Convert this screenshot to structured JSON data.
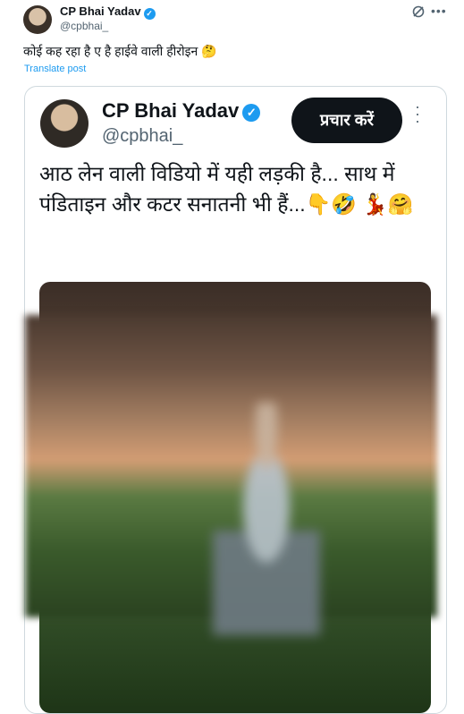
{
  "tweet": {
    "author_name": "CP Bhai Yadav",
    "handle": "@cpbhai_",
    "text": "कोई कह रहा है ए है हाईवे वाली हीरोइन 🤔",
    "translate_label": "Translate post"
  },
  "quoted": {
    "author_name": "CP Bhai Yadav",
    "handle": "@cpbhai_",
    "promote_label": "प्रचार करें",
    "text": "आठ लेन वाली विडियो में यही लड़की है... साथ में पंडिताइन और कटर सनातनी भी हैं...👇🤣 💃🤗"
  },
  "icons": {
    "verified": "verified-badge-icon",
    "grok": "grok-icon",
    "more": "more-icon"
  },
  "colors": {
    "accent": "#1d9bf0",
    "text": "#0f1419",
    "muted": "#536471",
    "border": "#cfd9de"
  }
}
